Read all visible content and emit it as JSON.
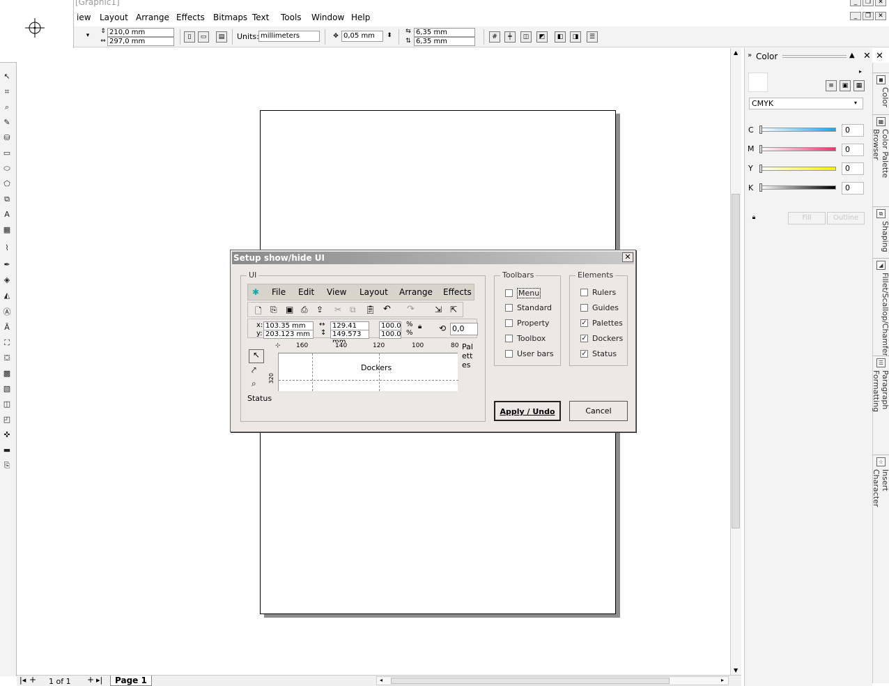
{
  "window": {
    "title": "[Graphic1]"
  },
  "menubar": {
    "items": [
      "iew",
      "Layout",
      "Arrange",
      "Effects",
      "Bitmaps",
      "Text",
      "Tools",
      "Window",
      "Help"
    ]
  },
  "propbar": {
    "page_width": "210,0 mm",
    "page_height": "297,0 mm",
    "units_label": "Units:",
    "units_value": "millimeters",
    "nudge": "0,05 mm",
    "dup_x": "6,35 mm",
    "dup_y": "6,35 mm"
  },
  "status": {
    "page_count": "1 of 1",
    "page_tab": "Page 1"
  },
  "docker": {
    "title": "Color",
    "model": "CMYK",
    "channels": [
      {
        "label": "C",
        "value": "0",
        "color": "#1aa3e6"
      },
      {
        "label": "M",
        "value": "0",
        "color": "#e8356e"
      },
      {
        "label": "Y",
        "value": "0",
        "color": "#f5f000"
      },
      {
        "label": "K",
        "value": "0",
        "color": "#000000"
      }
    ],
    "fill_label": "Fill",
    "outline_label": "Outline"
  },
  "docker_tabs": [
    "Color",
    "Color Palette Browser",
    "Shaping",
    "Fillet/Scallop/Chamfer",
    "Paragraph Formatting",
    "Insert Character"
  ],
  "dialog": {
    "title": "Setup show/hide UI",
    "ui_label": "UI",
    "toolbars_label": "Toolbars",
    "elements_label": "Elements",
    "toolbars": [
      {
        "label": "Menu",
        "checked": false
      },
      {
        "label": "Standard",
        "checked": false
      },
      {
        "label": "Property",
        "checked": false
      },
      {
        "label": "Toolbox",
        "checked": false
      },
      {
        "label": "User bars",
        "checked": false
      }
    ],
    "elements": [
      {
        "label": "Rulers",
        "checked": false
      },
      {
        "label": "Guides",
        "checked": false
      },
      {
        "label": "Palettes",
        "checked": true
      },
      {
        "label": "Dockers",
        "checked": true
      },
      {
        "label": "Status",
        "checked": true
      }
    ],
    "apply_label": "Apply / Undo",
    "cancel_label": "Cancel",
    "preview": {
      "menu": [
        "File",
        "Edit",
        "View",
        "Layout",
        "Arrange",
        "Effects"
      ],
      "x": "103.35 mm",
      "y": "203.123 mm",
      "w": "129.41 mm",
      "h": "149.573 mm",
      "sx": "100.0",
      "sy": "100.0",
      "pct": "%",
      "angle": "0,0",
      "ruler": [
        "160",
        "140",
        "120",
        "100",
        "80"
      ],
      "vruler": "320",
      "palettes_label": "Pal ett es",
      "dockers_label": "Dockers",
      "status_label": "Status"
    }
  }
}
